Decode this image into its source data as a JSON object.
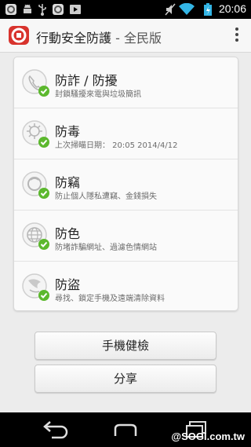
{
  "status_bar": {
    "time": "20:06",
    "notification_icons": [
      "app-notify-icon",
      "android-debug-icon",
      "usb-icon",
      "app-notify-icon",
      "media-play-icon"
    ],
    "system_icons": [
      "mute-icon",
      "wifi-icon",
      "battery-charging-icon"
    ]
  },
  "app_bar": {
    "title": "行動安全防護",
    "subtitle": " - 全民版",
    "logo_icon": "shield-logo-icon",
    "menu_icon": "overflow-menu-icon"
  },
  "features": [
    {
      "title": "防詐 / 防擾",
      "desc": "封鎖騷擾來電與垃圾簡訊",
      "icon": "phone-shield-icon",
      "status": "check-icon"
    },
    {
      "title": "防毒",
      "desc": "上次掃瞄日期： 20:05 2014/4/12",
      "icon": "virus-shield-icon",
      "status": "check-icon"
    },
    {
      "title": "防竊",
      "desc": "防止個人隱私遭竊、金錢損失",
      "icon": "privacy-shield-icon",
      "status": "check-icon"
    },
    {
      "title": "防色",
      "desc": "防堵詐騙網址、過濾色情網站",
      "icon": "globe-shield-icon",
      "status": "check-icon"
    },
    {
      "title": "防盜",
      "desc": "尋找、鎖定手機及遠端清除資料",
      "icon": "locate-shield-icon",
      "status": "check-icon"
    }
  ],
  "buttons": {
    "health_check": "手機健檢",
    "share": "分享"
  },
  "nav_bar": {
    "watermark": "@SOGI.com.tw"
  },
  "colors": {
    "check_green": "#5cb82e",
    "logo_red": "#d8332d",
    "background": "#ececec"
  }
}
